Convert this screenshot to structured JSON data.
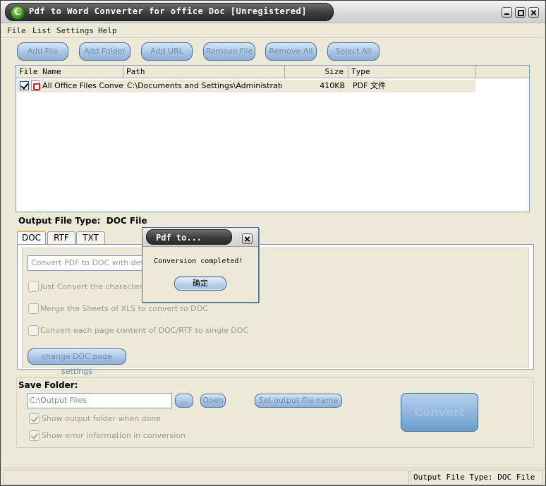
{
  "window": {
    "title": "Pdf to Word Converter for  office Doc [Unregistered]",
    "logo_letter": "C"
  },
  "menu": [
    "File",
    "List",
    "Settings",
    "Help"
  ],
  "toolbar": {
    "add_file": "Add File",
    "add_folder": "Add Folder",
    "add_url": "Add URL",
    "remove_file": "Remove File",
    "remove_all": "Remove All",
    "select_all": "Select All"
  },
  "file_list": {
    "columns": [
      "File Name",
      "Path",
      "Size",
      "Type"
    ],
    "rows": [
      {
        "checked": true,
        "name": "All Office Files Conver...",
        "path": "C:\\Documents and Settings\\Administrator\\...",
        "size": "410KB",
        "type": "PDF 文件"
      }
    ]
  },
  "output_type": {
    "label": "Output File Type:",
    "value": "DOC File"
  },
  "tabs": [
    "DOC",
    "RTF",
    "TXT"
  ],
  "doc_options": {
    "combo_value": "Convert PDF to DOC with default m",
    "opt_chars": "Just Convert the characters in t",
    "opt_xls": "Merge the Sheets of XLS to convert to DOC",
    "opt_single": "Convert each page content of DOC/RTF to single DOC",
    "change_btn": "change DOC page settings"
  },
  "save": {
    "label": "Save Folder:",
    "path": "C:\\Output Files",
    "browse": "...",
    "open": "Open",
    "set_name": "Set output file name",
    "convert": "Convert",
    "show_folder": "Show output folder when done",
    "show_error": "Show error information in conversion"
  },
  "status": {
    "right": "Output File Type:  DOC File"
  },
  "dialog": {
    "title": "Pdf to...",
    "message": "Conversion completed!",
    "ok": "确定"
  }
}
